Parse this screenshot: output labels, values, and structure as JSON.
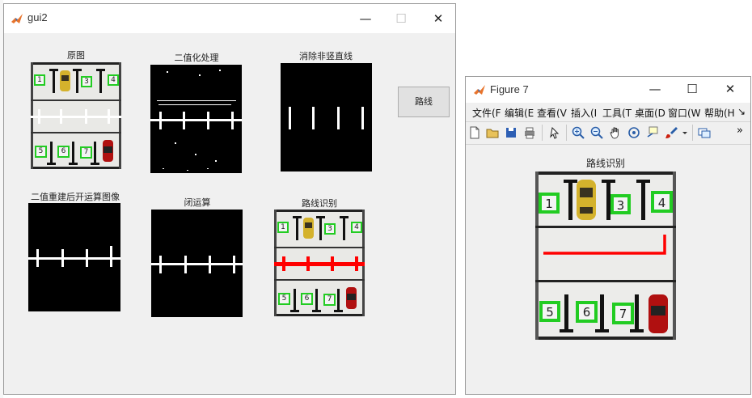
{
  "gui2": {
    "title": "gui2",
    "minimize": "—",
    "maximize": "☐",
    "close": "✕",
    "labels": {
      "original": "原图",
      "binarize": "二值化处理",
      "remove_lines": "消除非竖直线",
      "rebuild": "二值重建后开运算图像",
      "closing": "闭运算",
      "route": "路线识别"
    },
    "route_button": "路线"
  },
  "figure7": {
    "title": "Figure 7",
    "minimize": "—",
    "maximize": "☐",
    "close": "✕",
    "menus": [
      "文件(F",
      "编辑(E",
      "查看(V",
      "插入(I",
      "工具(T",
      "桌面(D",
      "窗口(W",
      "帮助(H"
    ],
    "menu_overflow": "↘",
    "toolbar_overflow": "»",
    "toolbar_icons": [
      "new-file-icon",
      "open-folder-icon",
      "save-icon",
      "print-icon",
      "pointer-icon",
      "zoom-in-icon",
      "zoom-out-icon",
      "pan-hand-icon",
      "rotate-3d-icon",
      "data-cursor-icon",
      "brush-icon",
      "brush-dropdown-icon",
      "link-plot-icon"
    ],
    "axes_title": "路线识别"
  },
  "parking_numbers": [
    "1",
    "3",
    "4",
    "5",
    "6",
    "7"
  ],
  "colors": {
    "window_bg": "#f0f0f0",
    "marker_green": "#22cc22",
    "route_red": "#ff0000",
    "car_yellow": "#d4b22c",
    "car_red": "#b01010"
  }
}
